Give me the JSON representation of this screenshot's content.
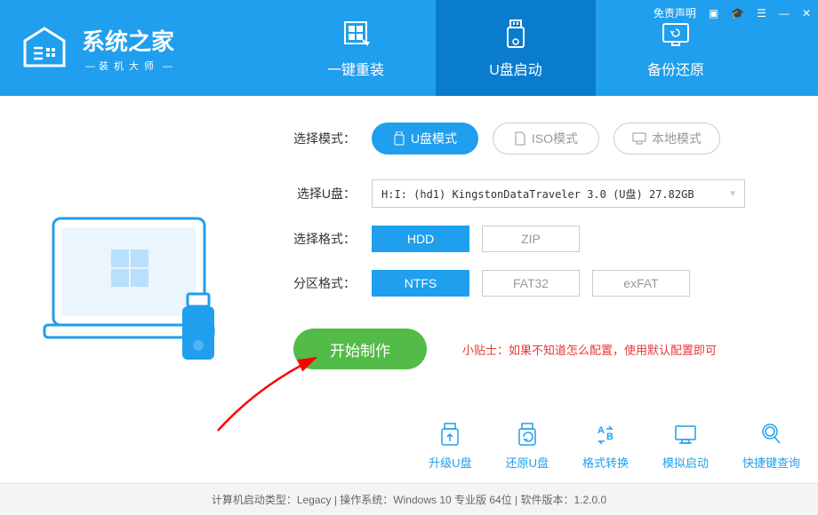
{
  "app": {
    "title": "系统之家",
    "subtitle": "装机大师"
  },
  "windowControls": {
    "disclaimer": "免责声明"
  },
  "tabs": {
    "reinstall": "一键重装",
    "usbboot": "U盘启动",
    "backup": "备份还原"
  },
  "modeRow": {
    "label": "选择模式：",
    "usb": "U盘模式",
    "iso": "ISO模式",
    "local": "本地模式"
  },
  "usbRow": {
    "label": "选择U盘：",
    "value": "H:I: (hd1) KingstonDataTraveler 3.0 (U盘) 27.82GB"
  },
  "formatRow": {
    "label": "选择格式：",
    "hdd": "HDD",
    "zip": "ZIP"
  },
  "partitionRow": {
    "label": "分区格式：",
    "ntfs": "NTFS",
    "fat32": "FAT32",
    "exfat": "exFAT"
  },
  "start": {
    "button": "开始制作",
    "tipLabel": "小贴士：",
    "tipText": "如果不知道怎么配置，使用默认配置即可"
  },
  "actions": {
    "upgrade": "升级U盘",
    "restore": "还原U盘",
    "convert": "格式转换",
    "simulate": "模拟启动",
    "shortcut": "快捷键查询"
  },
  "footer": {
    "text": "计算机启动类型：Legacy | 操作系统：Windows 10 专业版 64位 | 软件版本：1.2.0.0"
  }
}
